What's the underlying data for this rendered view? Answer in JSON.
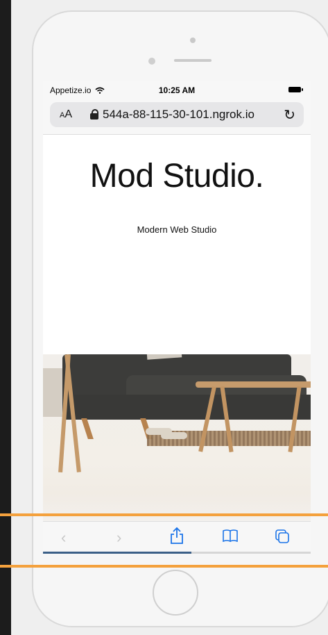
{
  "status_bar": {
    "carrier": "Appetize.io",
    "time": "10:25 AM"
  },
  "browser": {
    "text_size_button": "AA",
    "url": "544a-88-115-30-101.ngrok.io",
    "reload_icon": "reload-icon",
    "progress": 0.55
  },
  "page": {
    "title": "Mod Studio.",
    "tagline": "Modern Web Studio"
  },
  "toolbar": {
    "back_icon": "chevron-left-icon",
    "forward_icon": "chevron-right-icon",
    "share_icon": "share-icon",
    "bookmarks_icon": "book-icon",
    "tabs_icon": "tabs-icon"
  },
  "colors": {
    "accent": "#1a73e8",
    "highlight": "#f4a13d"
  }
}
